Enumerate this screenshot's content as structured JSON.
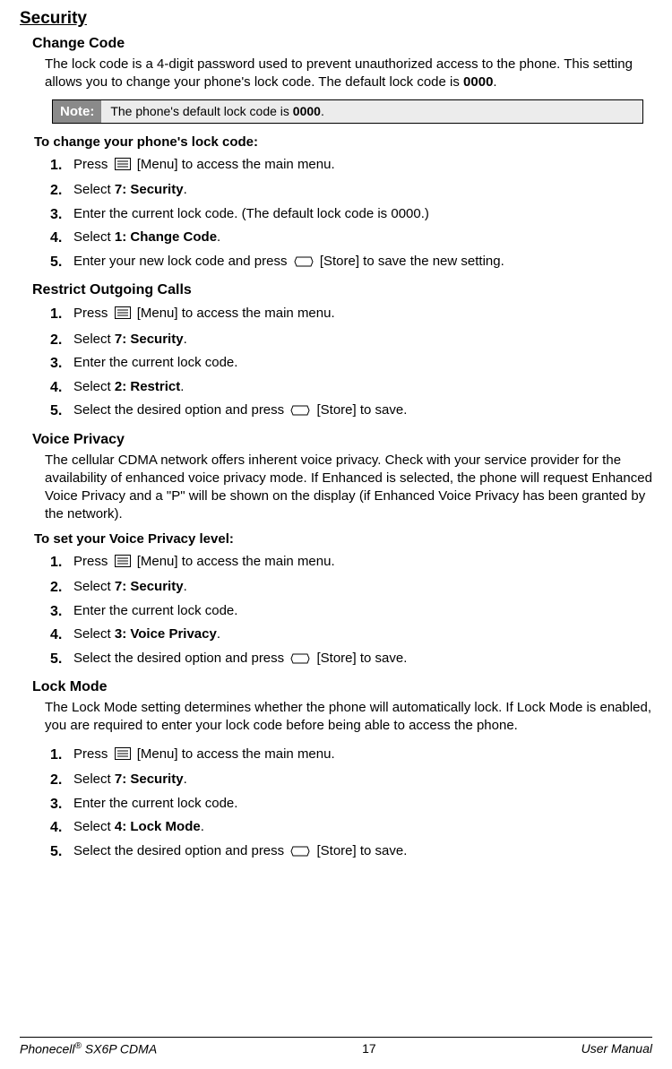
{
  "title": "Security",
  "changeCode": {
    "heading": "Change Code",
    "intro_a": "The lock code is a 4-digit password used to prevent unauthorized access to the phone. This setting allows you to change your phone's lock code. The default lock code is ",
    "intro_bold": "0000",
    "intro_b": ".",
    "noteLabel": "Note:",
    "note_a": "The phone's default lock code is ",
    "note_bold": "0000",
    "note_b": ".",
    "instrHead": "To change your phone's lock code:",
    "s1a": "Press ",
    "s1b": " [Menu] to access the main menu.",
    "s2a": "Select ",
    "s2bold": "7: Security",
    "s2b": ".",
    "s3": "Enter the current lock code. (The default lock code is 0000.)",
    "s4a": "Select ",
    "s4bold": "1: Change Code",
    "s4b": ".",
    "s5a": "Enter your new lock code and press ",
    "s5b": " [Store] to save the new setting."
  },
  "restrict": {
    "heading": "Restrict Outgoing Calls",
    "s1a": "Press ",
    "s1b": " [Menu] to access the main menu.",
    "s2a": "Select ",
    "s2bold": "7: Security",
    "s2b": ".",
    "s3": "Enter the current lock code.",
    "s4a": "Select ",
    "s4bold": "2: Restrict",
    "s4b": ".",
    "s5a": "Select the desired option and press ",
    "s5b": " [Store] to save."
  },
  "voice": {
    "heading": "Voice Privacy",
    "intro": "The cellular CDMA network offers inherent voice privacy. Check with your service provider for the availability of enhanced voice privacy mode. If Enhanced is selected, the phone will request Enhanced Voice Privacy and a \"P\" will be shown on the display (if Enhanced Voice Privacy has been granted by the network).",
    "instrHead": "To set your Voice Privacy level:",
    "s1a": "Press ",
    "s1b": " [Menu] to access the main menu.",
    "s2a": "Select ",
    "s2bold": "7: Security",
    "s2b": ".",
    "s3": "Enter the current lock code.",
    "s4a": "Select ",
    "s4bold": "3: Voice Privacy",
    "s4b": ".",
    "s5a": "Select the desired option and press ",
    "s5b": " [Store] to save."
  },
  "lock": {
    "heading": "Lock Mode",
    "intro": "The Lock Mode setting determines whether the phone will automatically lock. If Lock Mode is enabled, you are required to enter your lock code before being able to access the phone.",
    "s1a": "Press ",
    "s1b": " [Menu] to access the main menu.",
    "s2a": "Select ",
    "s2bold": "7: Security",
    "s2b": ".",
    "s3": "Enter the current lock code.",
    "s4a": "Select ",
    "s4bold": "4: Lock Mode",
    "s4b": ".",
    "s5a": "Select the desired option and press ",
    "s5b": " [Store] to save."
  },
  "footer": {
    "left_a": "Phonecell",
    "left_reg": "®",
    "left_b": " SX6P CDMA",
    "center": "17",
    "right": "User Manual"
  }
}
